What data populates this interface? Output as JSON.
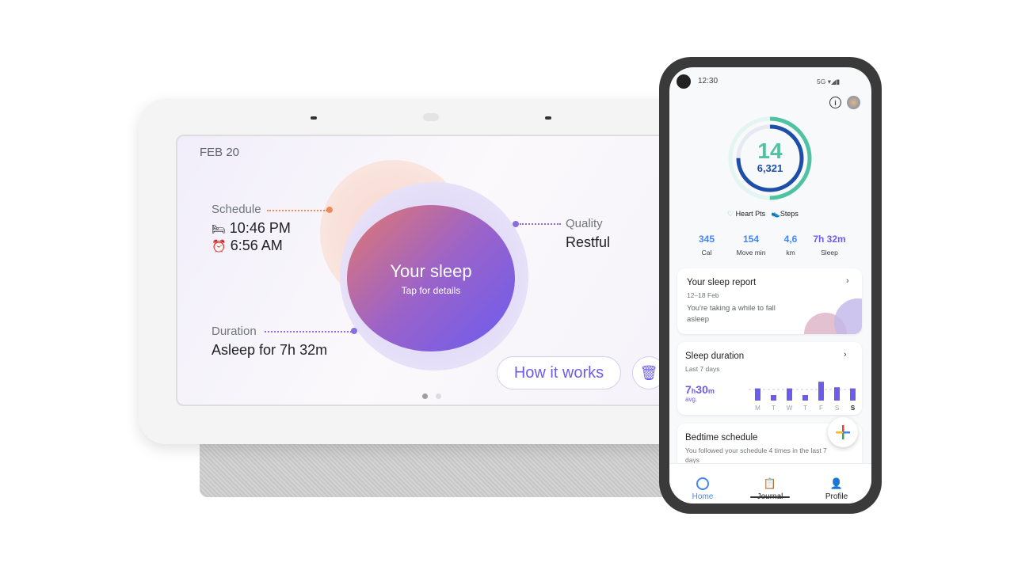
{
  "hub": {
    "date": "FEB 20",
    "schedule_label": "Schedule",
    "bedtime": "10:46 PM",
    "wake_time": "6:56 AM",
    "quality_label": "Quality",
    "quality_value": "Restful",
    "duration_label": "Duration",
    "duration_value": "Asleep for 7h 32m",
    "center_title": "Your sleep",
    "center_subtitle": "Tap for details",
    "how_button": "How it works",
    "page_indicator": {
      "pages": 2,
      "current": 1
    },
    "colors": {
      "accent": "#6b5de8",
      "schedule_dot": "#f08a5d",
      "quality_dot": "#8a6ee0"
    }
  },
  "phone": {
    "status": {
      "time": "12:30",
      "network": "5G"
    },
    "ring": {
      "heart_pts": "14",
      "steps": "6,321",
      "heart_legend": "Heart Pts",
      "steps_legend": "Steps",
      "heart_progress": 0.5,
      "steps_progress": 0.75
    },
    "stats": [
      {
        "value": "345",
        "label": "Cal"
      },
      {
        "value": "154",
        "label": "Move min"
      },
      {
        "value": "4,6",
        "label": "km"
      },
      {
        "value": "7h 32m",
        "label": "Sleep"
      }
    ],
    "sleep_report": {
      "title": "Your sleep report",
      "dates": "12–18 Feb",
      "text": "You're taking a while to fall asleep"
    },
    "sleep_duration": {
      "title": "Sleep duration",
      "subtitle": "Last 7 days",
      "avg_h": "7",
      "avg_m": "30",
      "avg_label": "avg."
    },
    "bedtime": {
      "title": "Bedtime schedule",
      "text": "You followed your schedule 4 times in the last 7 days"
    },
    "nav": [
      {
        "label": "Home"
      },
      {
        "label": "Journal"
      },
      {
        "label": "Profile"
      }
    ],
    "colors": {
      "heart": "#4fc3a1",
      "steps": "#1e4fa8",
      "sleep": "#6b5de8",
      "link": "#4285f4"
    }
  },
  "chart_data": {
    "type": "bar",
    "categories": [
      "M",
      "T",
      "W",
      "T",
      "F",
      "S",
      "S"
    ],
    "values": [
      7.6,
      7.0,
      7.6,
      7.0,
      8.2,
      7.7,
      7.6
    ],
    "average": 7.5,
    "ylabel": "",
    "xlabel": ""
  }
}
